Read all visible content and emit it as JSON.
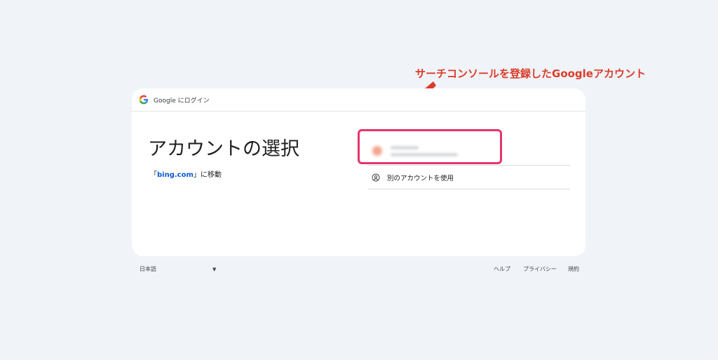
{
  "annotation": {
    "label": "サーチコンソールを登録したGoogleアカウント",
    "color": "#d93c2a"
  },
  "header": {
    "brand_text": "Google にログイン"
  },
  "main": {
    "title": "アカウントの選択",
    "subtitle_prefix": "「",
    "subtitle_link": "bing.com",
    "subtitle_suffix": "」に移動"
  },
  "accounts": {
    "use_other_label": "別のアカウントを使用",
    "highlight_color": "#e8356c"
  },
  "footer": {
    "language": "日本語",
    "help": "ヘルプ",
    "privacy": "プライバシー",
    "terms": "規約"
  },
  "icons": {
    "logo": "google-g-icon",
    "use_other": "account-circle-icon",
    "caret": "caret-down-icon",
    "arrow": "annotation-arrow-icon"
  }
}
